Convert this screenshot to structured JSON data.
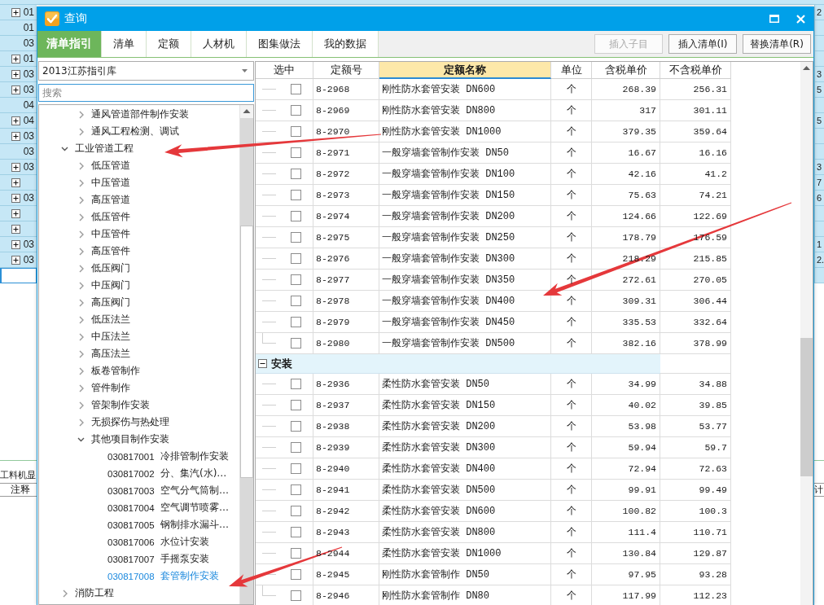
{
  "sheet": {
    "rows": [
      {
        "expandable": true,
        "selected": false,
        "left_cell": "01",
        "right_cell": "2"
      },
      {
        "expandable": false,
        "selected": false,
        "left_cell": "01"
      },
      {
        "expandable": false,
        "selected": false,
        "left_cell": "03"
      },
      {
        "expandable": true,
        "selected": false,
        "left_cell": "01"
      },
      {
        "expandable": true,
        "selected": false,
        "left_cell": "03",
        "right_cell": "3"
      },
      {
        "expandable": true,
        "selected": false,
        "left_cell": "03",
        "right_cell": "5"
      },
      {
        "expandable": false,
        "selected": false,
        "left_cell": "04"
      },
      {
        "expandable": true,
        "selected": false,
        "left_cell": "04",
        "right_cell": "5"
      },
      {
        "expandable": true,
        "selected": false,
        "left_cell": "03"
      },
      {
        "expandable": false,
        "selected": false,
        "left_cell": "03"
      },
      {
        "expandable": true,
        "selected": false,
        "left_cell": "03",
        "right_cell": "3"
      },
      {
        "expandable": true,
        "selected": false,
        "right_cell": "7"
      },
      {
        "expandable": true,
        "selected": false,
        "left_cell": "03",
        "right_cell": "6"
      },
      {
        "expandable": true,
        "selected": false
      },
      {
        "expandable": true,
        "selected": false
      },
      {
        "expandable": true,
        "selected": false,
        "left_cell": "03",
        "right_cell": "1"
      },
      {
        "expandable": true,
        "selected": false,
        "left_cell": "03",
        "right_cell": "2."
      },
      {
        "expandable": false,
        "selected": true
      }
    ],
    "lower_panel": {
      "tab": "工料机显",
      "left_header": "注释",
      "right_header": "计"
    }
  },
  "dialog": {
    "title": "查询",
    "tabs": [
      {
        "label": "清单指引",
        "selected": true
      },
      {
        "label": "清单",
        "selected": false
      },
      {
        "label": "定额",
        "selected": false
      },
      {
        "label": "人材机",
        "selected": false
      },
      {
        "label": "图集做法",
        "selected": false
      },
      {
        "label": "我的数据",
        "selected": false
      }
    ],
    "toolbar": {
      "buttons": [
        {
          "label": "插入子目",
          "disabled": true
        },
        {
          "label": "插入清单(I)",
          "disabled": false
        },
        {
          "label": "替换清单(R)",
          "disabled": false
        }
      ]
    },
    "library_dropdown": {
      "value": "2013江苏指引库"
    },
    "search": {
      "placeholder": "搜索"
    },
    "tree": {
      "items": [
        {
          "children": [
            {
              "label": "通风管道部件制作安装",
              "expanded": false,
              "selected": false
            },
            {
              "label": "通风工程检测、调试",
              "expanded": false,
              "selected": false
            }
          ]
        },
        {
          "label": "工业管道工程",
          "expanded": true,
          "selected": false,
          "children": [
            {
              "label": "低压管道",
              "expanded": false,
              "selected": false
            },
            {
              "label": "中压管道",
              "expanded": false,
              "selected": false
            },
            {
              "label": "高压管道",
              "expanded": false,
              "selected": false
            },
            {
              "label": "低压管件",
              "expanded": false,
              "selected": false
            },
            {
              "label": "中压管件",
              "expanded": false,
              "selected": false
            },
            {
              "label": "高压管件",
              "expanded": false,
              "selected": false
            },
            {
              "label": "低压阀门",
              "expanded": false,
              "selected": false
            },
            {
              "label": "中压阀门",
              "expanded": false,
              "selected": false
            },
            {
              "label": "高压阀门",
              "expanded": false,
              "selected": false
            },
            {
              "label": "低压法兰",
              "expanded": false,
              "selected": false
            },
            {
              "label": "中压法兰",
              "expanded": false,
              "selected": false
            },
            {
              "label": "高压法兰",
              "expanded": false,
              "selected": false
            },
            {
              "label": "板卷管制作",
              "expanded": false,
              "selected": false
            },
            {
              "label": "管件制作",
              "expanded": false,
              "selected": false
            },
            {
              "label": "管架制作安装",
              "expanded": false,
              "selected": false
            },
            {
              "label": "无损探伤与热处理",
              "expanded": false,
              "selected": false
            },
            {
              "label": "其他项目制作安装",
              "expanded": true,
              "selected": false,
              "children": [
                {
                  "code": "030817001",
                  "name": "冷排管制作安装",
                  "selected": false
                },
                {
                  "code": "030817002",
                  "name": "分、集汽(水)…",
                  "selected": false
                },
                {
                  "code": "030817003",
                  "name": "空气分气筒制…",
                  "selected": false
                },
                {
                  "code": "030817004",
                  "name": "空气调节喷雾…",
                  "selected": false
                },
                {
                  "code": "030817005",
                  "name": "钢制排水漏斗…",
                  "selected": false
                },
                {
                  "code": "030817006",
                  "name": "水位计安装",
                  "selected": false
                },
                {
                  "code": "030817007",
                  "name": "手摇泵安装",
                  "selected": false
                },
                {
                  "code": "030817008",
                  "name": "套管制作安装",
                  "selected": true
                }
              ]
            }
          ]
        },
        {
          "label": "消防工程",
          "expanded": false,
          "selected": false
        }
      ]
    },
    "table": {
      "columns": [
        {
          "label": "选中",
          "selected": false
        },
        {
          "label": "定额号",
          "selected": false
        },
        {
          "label": "定额名称",
          "selected": true
        },
        {
          "label": "单位",
          "selected": false
        },
        {
          "label": "含税单价",
          "selected": false
        },
        {
          "label": "不含税单价",
          "selected": false
        }
      ],
      "groups": [
        {
          "rows": [
            {
              "checked": false,
              "quota_no": "8-2968",
              "quota_name": "刚性防水套管安装 DN600",
              "unit": "个",
              "price_incl_tax": "268.39",
              "price_excl_tax": "256.31"
            },
            {
              "checked": false,
              "quota_no": "8-2969",
              "quota_name": "刚性防水套管安装 DN800",
              "unit": "个",
              "price_incl_tax": "317",
              "price_excl_tax": "301.11"
            },
            {
              "checked": false,
              "quota_no": "8-2970",
              "quota_name": "刚性防水套管安装 DN1000",
              "unit": "个",
              "price_incl_tax": "379.35",
              "price_excl_tax": "359.64"
            },
            {
              "checked": false,
              "quota_no": "8-2971",
              "quota_name": "一般穿墙套管制作安装 DN50",
              "unit": "个",
              "price_incl_tax": "16.67",
              "price_excl_tax": "16.16"
            },
            {
              "checked": false,
              "quota_no": "8-2972",
              "quota_name": "一般穿墙套管制作安装 DN100",
              "unit": "个",
              "price_incl_tax": "42.16",
              "price_excl_tax": "41.2"
            },
            {
              "checked": false,
              "quota_no": "8-2973",
              "quota_name": "一般穿墙套管制作安装 DN150",
              "unit": "个",
              "price_incl_tax": "75.63",
              "price_excl_tax": "74.21"
            },
            {
              "checked": false,
              "quota_no": "8-2974",
              "quota_name": "一般穿墙套管制作安装 DN200",
              "unit": "个",
              "price_incl_tax": "124.66",
              "price_excl_tax": "122.69"
            },
            {
              "checked": false,
              "quota_no": "8-2975",
              "quota_name": "一般穿墙套管制作安装 DN250",
              "unit": "个",
              "price_incl_tax": "178.79",
              "price_excl_tax": "176.59"
            },
            {
              "checked": false,
              "quota_no": "8-2976",
              "quota_name": "一般穿墙套管制作安装 DN300",
              "unit": "个",
              "price_incl_tax": "218.29",
              "price_excl_tax": "215.85"
            },
            {
              "checked": false,
              "quota_no": "8-2977",
              "quota_name": "一般穿墙套管制作安装 DN350",
              "unit": "个",
              "price_incl_tax": "272.61",
              "price_excl_tax": "270.05"
            },
            {
              "checked": false,
              "quota_no": "8-2978",
              "quota_name": "一般穿墙套管制作安装 DN400",
              "unit": "个",
              "price_incl_tax": "309.31",
              "price_excl_tax": "306.44"
            },
            {
              "checked": false,
              "quota_no": "8-2979",
              "quota_name": "一般穿墙套管制作安装 DN450",
              "unit": "个",
              "price_incl_tax": "335.53",
              "price_excl_tax": "332.64"
            },
            {
              "checked": false,
              "quota_no": "8-2980",
              "quota_name": "一般穿墙套管制作安装 DN500",
              "unit": "个",
              "price_incl_tax": "382.16",
              "price_excl_tax": "378.99"
            }
          ]
        },
        {
          "title": "安装",
          "expanded": true,
          "rows": [
            {
              "checked": false,
              "quota_no": "8-2936",
              "quota_name": "柔性防水套管安装 DN50",
              "unit": "个",
              "price_incl_tax": "34.99",
              "price_excl_tax": "34.88"
            },
            {
              "checked": false,
              "quota_no": "8-2937",
              "quota_name": "柔性防水套管安装 DN150",
              "unit": "个",
              "price_incl_tax": "40.02",
              "price_excl_tax": "39.85"
            },
            {
              "checked": false,
              "quota_no": "8-2938",
              "quota_name": "柔性防水套管安装 DN200",
              "unit": "个",
              "price_incl_tax": "53.98",
              "price_excl_tax": "53.77"
            },
            {
              "checked": false,
              "quota_no": "8-2939",
              "quota_name": "柔性防水套管安装 DN300",
              "unit": "个",
              "price_incl_tax": "59.94",
              "price_excl_tax": "59.7"
            },
            {
              "checked": false,
              "quota_no": "8-2940",
              "quota_name": "柔性防水套管安装 DN400",
              "unit": "个",
              "price_incl_tax": "72.94",
              "price_excl_tax": "72.63"
            },
            {
              "checked": false,
              "quota_no": "8-2941",
              "quota_name": "柔性防水套管安装 DN500",
              "unit": "个",
              "price_incl_tax": "99.91",
              "price_excl_tax": "99.49"
            },
            {
              "checked": false,
              "quota_no": "8-2942",
              "quota_name": "柔性防水套管安装 DN600",
              "unit": "个",
              "price_incl_tax": "100.82",
              "price_excl_tax": "100.3"
            },
            {
              "checked": false,
              "quota_no": "8-2943",
              "quota_name": "柔性防水套管安装 DN800",
              "unit": "个",
              "price_incl_tax": "111.4",
              "price_excl_tax": "110.71"
            },
            {
              "checked": false,
              "quota_no": "8-2944",
              "quota_name": "柔性防水套管安装 DN1000",
              "unit": "个",
              "price_incl_tax": "130.84",
              "price_excl_tax": "129.87"
            },
            {
              "checked": false,
              "quota_no": "8-2945",
              "quota_name": "刚性防水套管制作 DN50",
              "unit": "个",
              "price_incl_tax": "97.95",
              "price_excl_tax": "93.28"
            },
            {
              "checked": false,
              "quota_no": "8-2946",
              "quota_name": "刚性防水套管制作 DN80",
              "unit": "个",
              "price_incl_tax": "117.99",
              "price_excl_tax": "112.23"
            }
          ]
        }
      ]
    }
  },
  "annotations": [
    {
      "kind": "arrow"
    },
    {
      "kind": "arrow"
    },
    {
      "kind": "arrow"
    }
  ]
}
